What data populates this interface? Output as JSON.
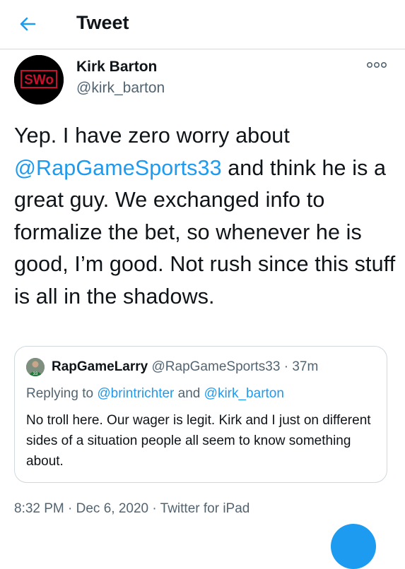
{
  "header": {
    "title": "Tweet",
    "back_icon": "arrow-left-icon"
  },
  "tweet": {
    "author_name": "Kirk Barton",
    "author_handle": "@kirk_barton",
    "avatar_text": "SWo",
    "text_segments": [
      {
        "text": "Yep.  I have zero worry about ",
        "mention": false
      },
      {
        "text": "@RapGameSports33",
        "mention": true
      },
      {
        "text": " and think he is a great guy.  We exchanged info to formalize the bet, so whenever he is good, I’m good.  Not rush since this stuff is all in the shadows.",
        "mention": false
      }
    ],
    "timestamp": "8:32 PM · Dec 6, 2020 · Twitter for iPad"
  },
  "quote": {
    "author_name": "RapGameLarry",
    "meta": "@RapGameSports33 · 37m",
    "reply_prefix": "Replying to ",
    "reply_user1": "@brintrichter",
    "reply_and": " and ",
    "reply_user2": "@kirk_barton",
    "text": "No troll here. Our wager is legit. Kirk and I just on different sides of a situation people all seem to know something about."
  },
  "colors": {
    "accent": "#1d9bf0",
    "text": "#0f1419",
    "muted": "#536471",
    "border": "#cfd9de",
    "avatar_red": "#c8102e"
  }
}
